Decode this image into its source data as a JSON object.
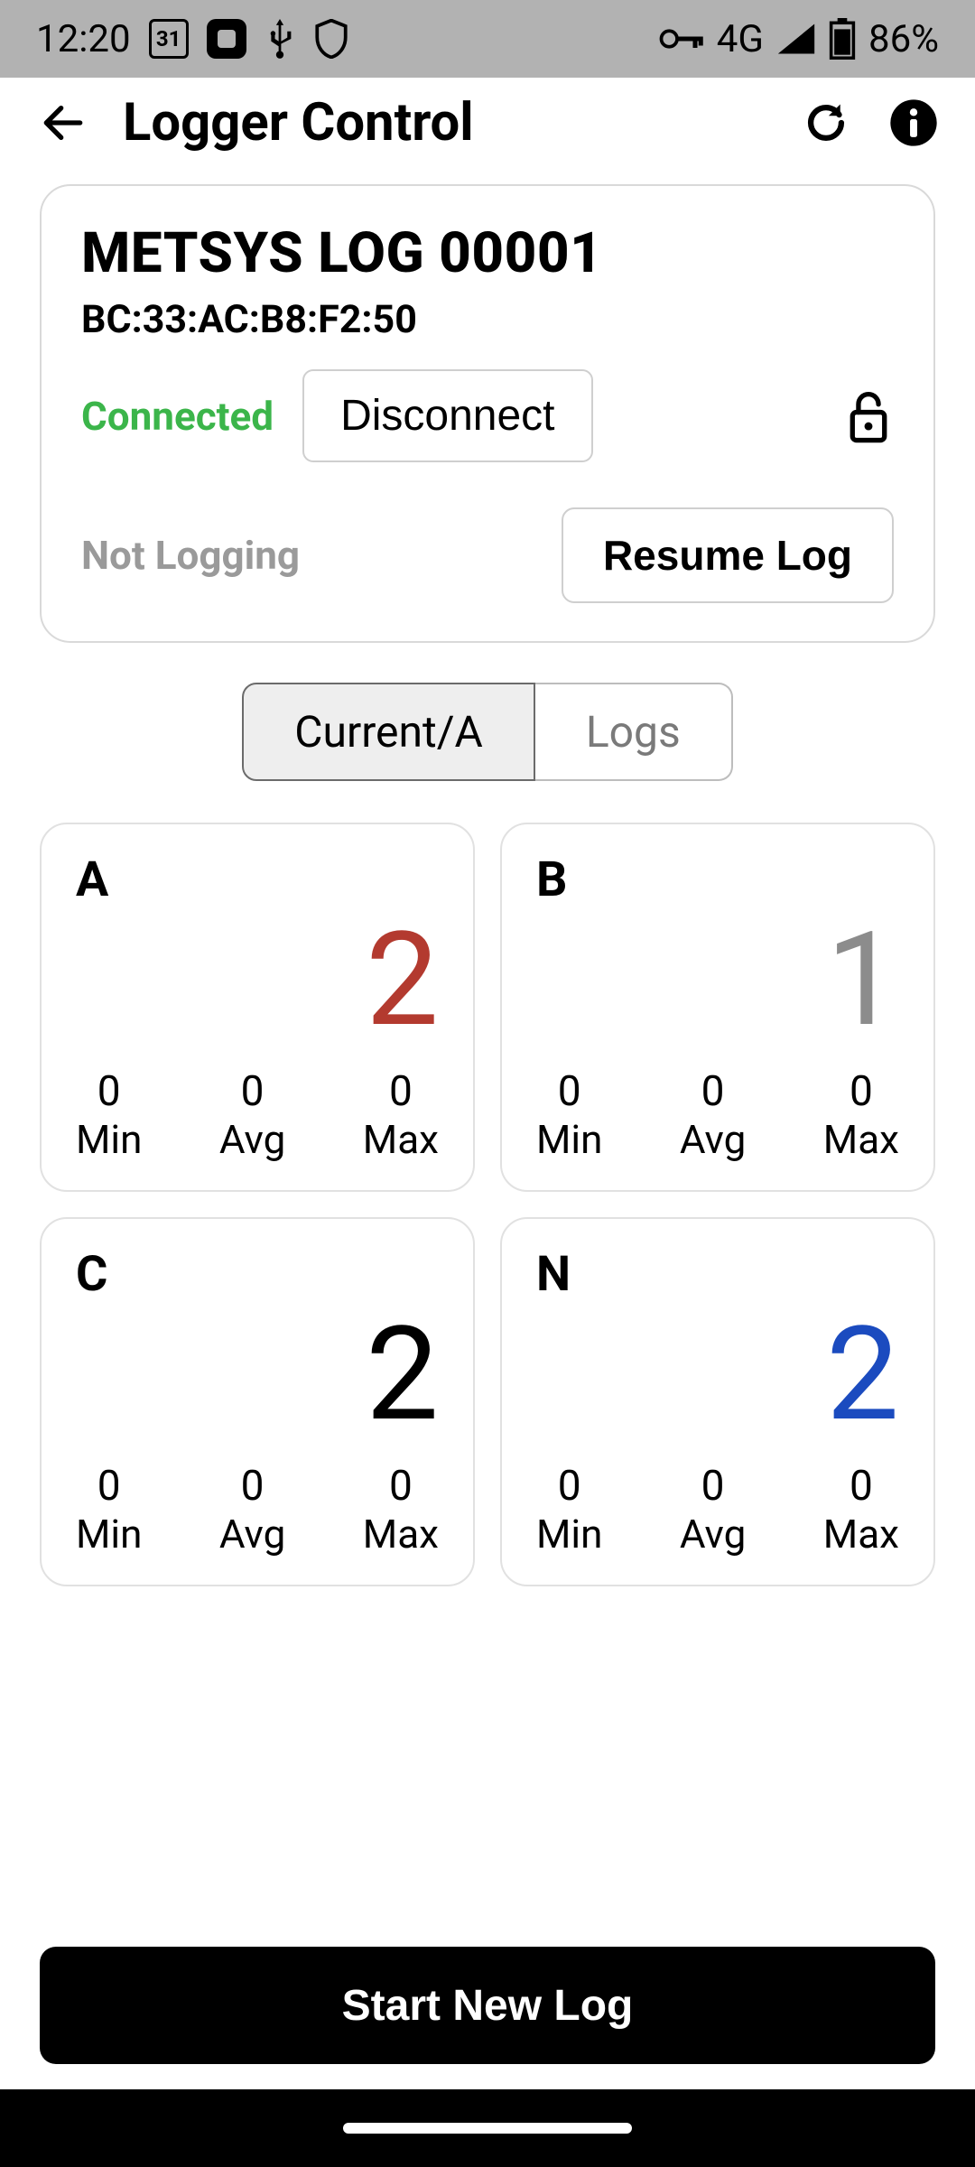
{
  "status_bar": {
    "time": "12:20",
    "calendar_day": "31",
    "network_label": "4G",
    "battery_pct": "86%"
  },
  "header": {
    "title": "Logger Control"
  },
  "device": {
    "name": "METSYS LOG 00001",
    "mac": "BC:33:AC:B8:F2:50",
    "connection_status": "Connected",
    "disconnect_label": "Disconnect",
    "logging_status": "Not Logging",
    "resume_label": "Resume Log"
  },
  "tabs": {
    "current": "Current/A",
    "logs": "Logs"
  },
  "channels": [
    {
      "label": "A",
      "value": "2",
      "color": "red",
      "min": "0",
      "avg": "0",
      "max": "0"
    },
    {
      "label": "B",
      "value": "1",
      "color": "gray",
      "min": "0",
      "avg": "0",
      "max": "0"
    },
    {
      "label": "C",
      "value": "2",
      "color": "black",
      "min": "0",
      "avg": "0",
      "max": "0"
    },
    {
      "label": "N",
      "value": "2",
      "color": "blue",
      "min": "0",
      "avg": "0",
      "max": "0"
    }
  ],
  "stat_labels": {
    "min": "Min",
    "avg": "Avg",
    "max": "Max"
  },
  "start_button_label": "Start New Log"
}
